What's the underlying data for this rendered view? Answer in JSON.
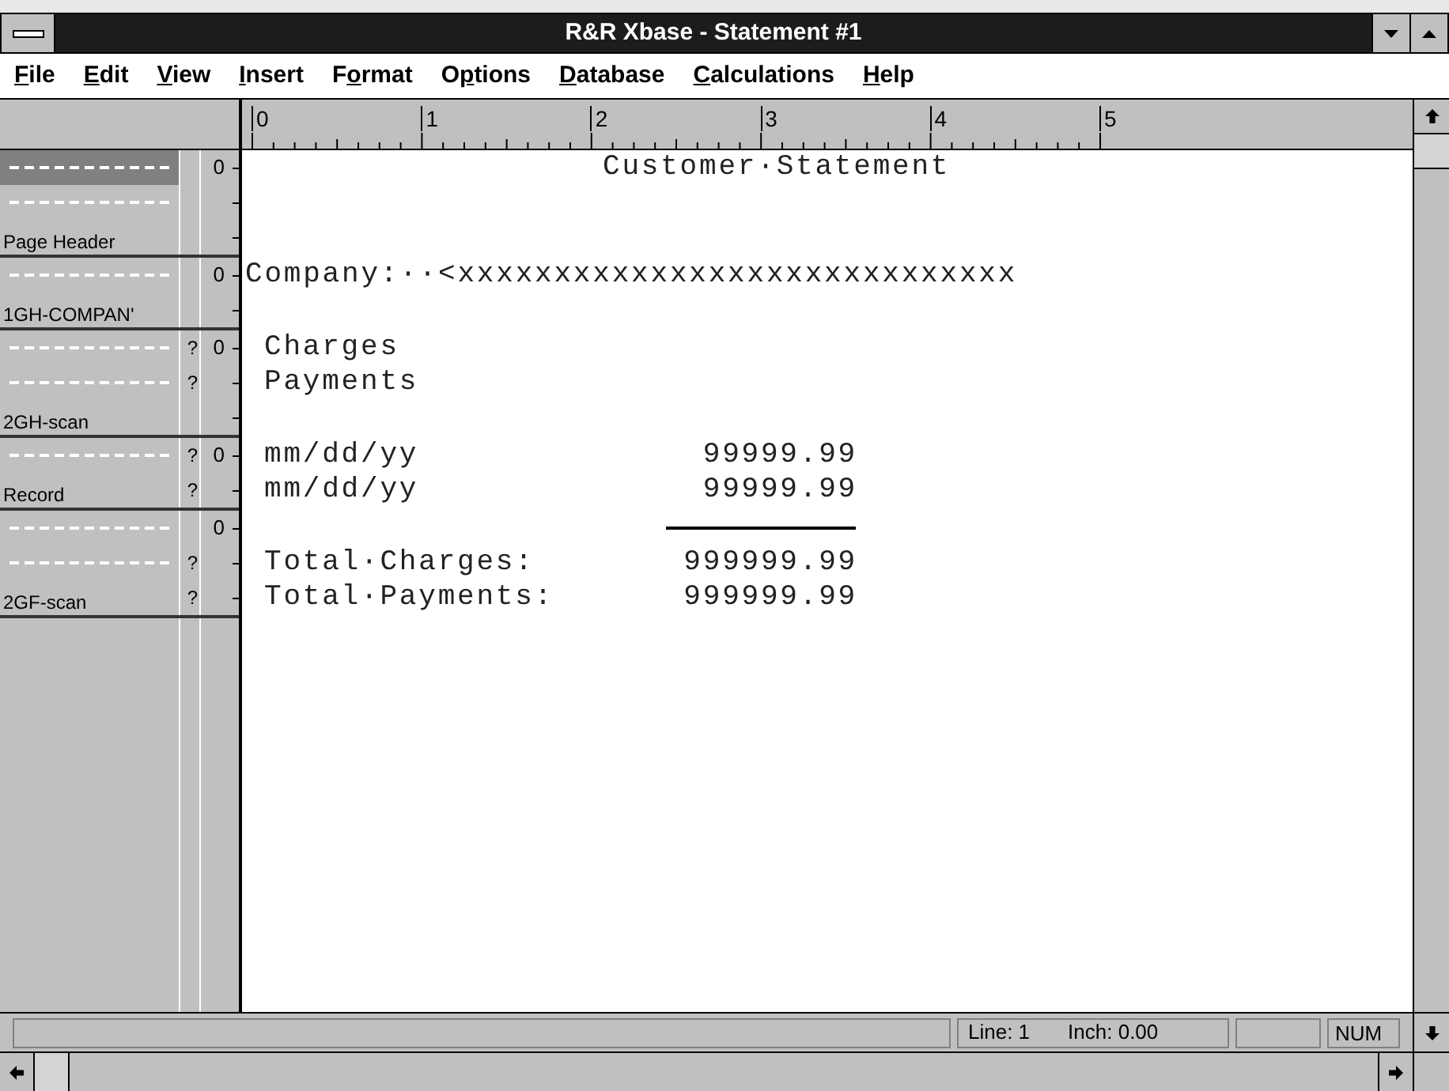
{
  "window": {
    "title": "R&R Xbase - Statement #1"
  },
  "menu": [
    {
      "accel": "F",
      "after": "ile"
    },
    {
      "accel": "E",
      "after": "dit"
    },
    {
      "accel": "V",
      "after": "iew"
    },
    {
      "accel": "I",
      "after": "nsert"
    },
    {
      "before": "F",
      "accel": "o",
      "after": "rmat"
    },
    {
      "before": "O",
      "accel": "p",
      "after": "tions"
    },
    {
      "accel": "D",
      "after": "atabase"
    },
    {
      "accel": "C",
      "after": "alculations"
    },
    {
      "accel": "H",
      "after": "elp"
    }
  ],
  "ruler": [
    "0",
    "1",
    "2",
    "3",
    "4",
    "5"
  ],
  "sections": [
    {
      "label": "Page Header",
      "rows": [
        {
          "number": "0",
          "selected": true,
          "kind": "title",
          "text": "Customer·Statement"
        },
        {
          "selected": false
        },
        {
          "selected": false
        }
      ]
    },
    {
      "label": "1GH-COMPAN'",
      "rows": [
        {
          "number": "0",
          "selected": false,
          "kind": "field",
          "text": "Company:··<xxxxxxxxxxxxxxxxxxxxxxxxxxxxx"
        },
        {
          "selected": false
        }
      ]
    },
    {
      "label": "2GH-scan",
      "rows": [
        {
          "mark": "?",
          "number": "0",
          "selected": false,
          "kind": "label",
          "text": "Charges"
        },
        {
          "mark": "?",
          "selected": false,
          "kind": "label",
          "text": "Payments"
        },
        {
          "selected": false
        }
      ]
    },
    {
      "label": "Record",
      "rows": [
        {
          "mark": "?",
          "number": "0",
          "selected": false,
          "kind": "detail",
          "text": "mm/dd/yy",
          "amount": "99999.99"
        },
        {
          "mark": "?",
          "selected": false,
          "kind": "detail",
          "text": "mm/dd/yy",
          "amount": "99999.99"
        }
      ]
    },
    {
      "label": "2GF-scan",
      "rows": [
        {
          "number": "0",
          "selected": false,
          "kind": "rule"
        },
        {
          "mark": "?",
          "selected": false,
          "kind": "detail",
          "text": "Total·Charges:",
          "amount": "999999.99"
        },
        {
          "mark": "?",
          "selected": false,
          "kind": "detail",
          "text": "Total·Payments:",
          "amount": "999999.99"
        }
      ]
    }
  ],
  "status_bar": {
    "position": "Line: 1",
    "inch": "Inch: 0.00",
    "mode": "NUM"
  }
}
